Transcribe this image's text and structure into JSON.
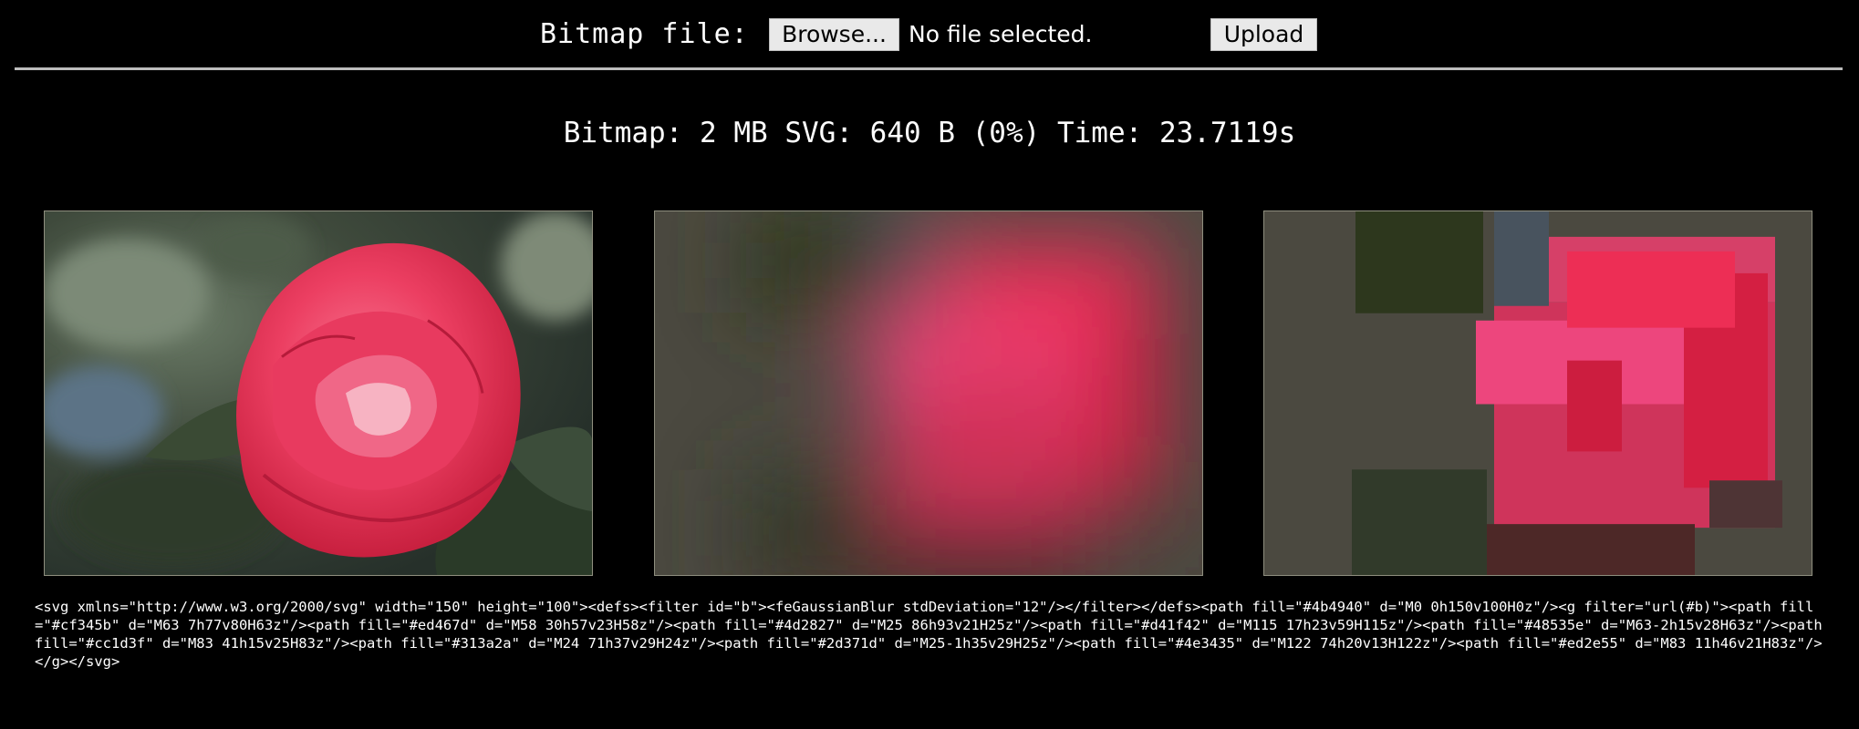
{
  "upload": {
    "label": "Bitmap file:",
    "browse_label": "Browse...",
    "file_status": "No file selected.",
    "upload_label": "Upload"
  },
  "stats": {
    "text": "Bitmap: 2 MB SVG: 640 B (0%) Time: 23.7119s"
  },
  "panels": {
    "original": {
      "description_icon": "camellia-photo",
      "colors": {
        "petal": "#e8345a",
        "petal_light": "#f06a85",
        "leaf": "#2f3a2a",
        "background": "#4b4940"
      }
    },
    "blurred": {
      "background": "#4b4940",
      "glow": "#e8345a"
    },
    "shapes": {
      "background": "#4b4940"
    }
  },
  "svg_code": {
    "text": "<svg xmlns=\"http://www.w3.org/2000/svg\" width=\"150\" height=\"100\"><defs><filter id=\"b\"><feGaussianBlur stdDeviation=\"12\"/></filter></defs><path fill=\"#4b4940\" d=\"M0 0h150v100H0z\"/><g filter=\"url(#b)\"><path fill=\"#cf345b\" d=\"M63 7h77v80H63z\"/><path fill=\"#ed467d\" d=\"M58 30h57v23H58z\"/><path fill=\"#4d2827\" d=\"M25 86h93v21H25z\"/><path fill=\"#d41f42\" d=\"M115 17h23v59H115z\"/><path fill=\"#48535e\" d=\"M63-2h15v28H63z\"/><path fill=\"#cc1d3f\" d=\"M83 41h15v25H83z\"/><path fill=\"#313a2a\" d=\"M24 71h37v29H24z\"/><path fill=\"#2d371d\" d=\"M25-1h35v29H25z\"/><path fill=\"#4e3435\" d=\"M122 74h20v13H122z\"/><path fill=\"#ed2e55\" d=\"M83 11h46v21H83z\"/></g></svg>"
  }
}
